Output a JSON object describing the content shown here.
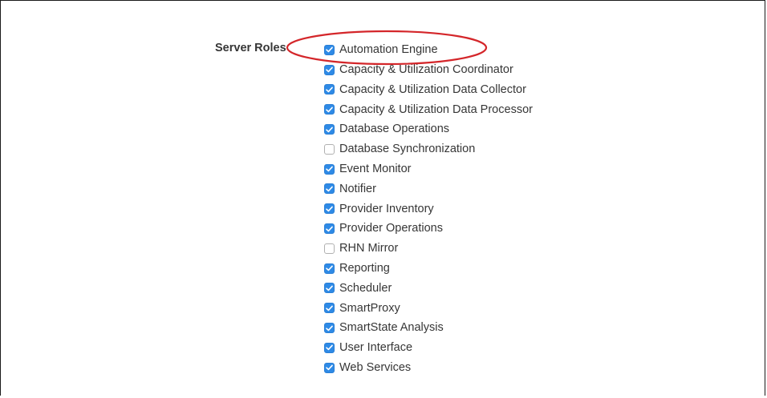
{
  "server_roles": {
    "label": "Server Roles",
    "accent_color": "#2e8ae6",
    "highlight_color": "#d4262a",
    "roles": [
      {
        "name": "Automation Engine",
        "checked": true
      },
      {
        "name": "Capacity & Utilization Coordinator",
        "checked": true
      },
      {
        "name": "Capacity & Utilization Data Collector",
        "checked": true
      },
      {
        "name": "Capacity & Utilization Data Processor",
        "checked": true
      },
      {
        "name": "Database Operations",
        "checked": true
      },
      {
        "name": "Database Synchronization",
        "checked": false
      },
      {
        "name": "Event Monitor",
        "checked": true
      },
      {
        "name": "Notifier",
        "checked": true
      },
      {
        "name": "Provider Inventory",
        "checked": true
      },
      {
        "name": "Provider Operations",
        "checked": true
      },
      {
        "name": "RHN Mirror",
        "checked": false
      },
      {
        "name": "Reporting",
        "checked": true
      },
      {
        "name": "Scheduler",
        "checked": true
      },
      {
        "name": "SmartProxy",
        "checked": true
      },
      {
        "name": "SmartState Analysis",
        "checked": true
      },
      {
        "name": "User Interface",
        "checked": true
      },
      {
        "name": "Web Services",
        "checked": true
      }
    ]
  }
}
